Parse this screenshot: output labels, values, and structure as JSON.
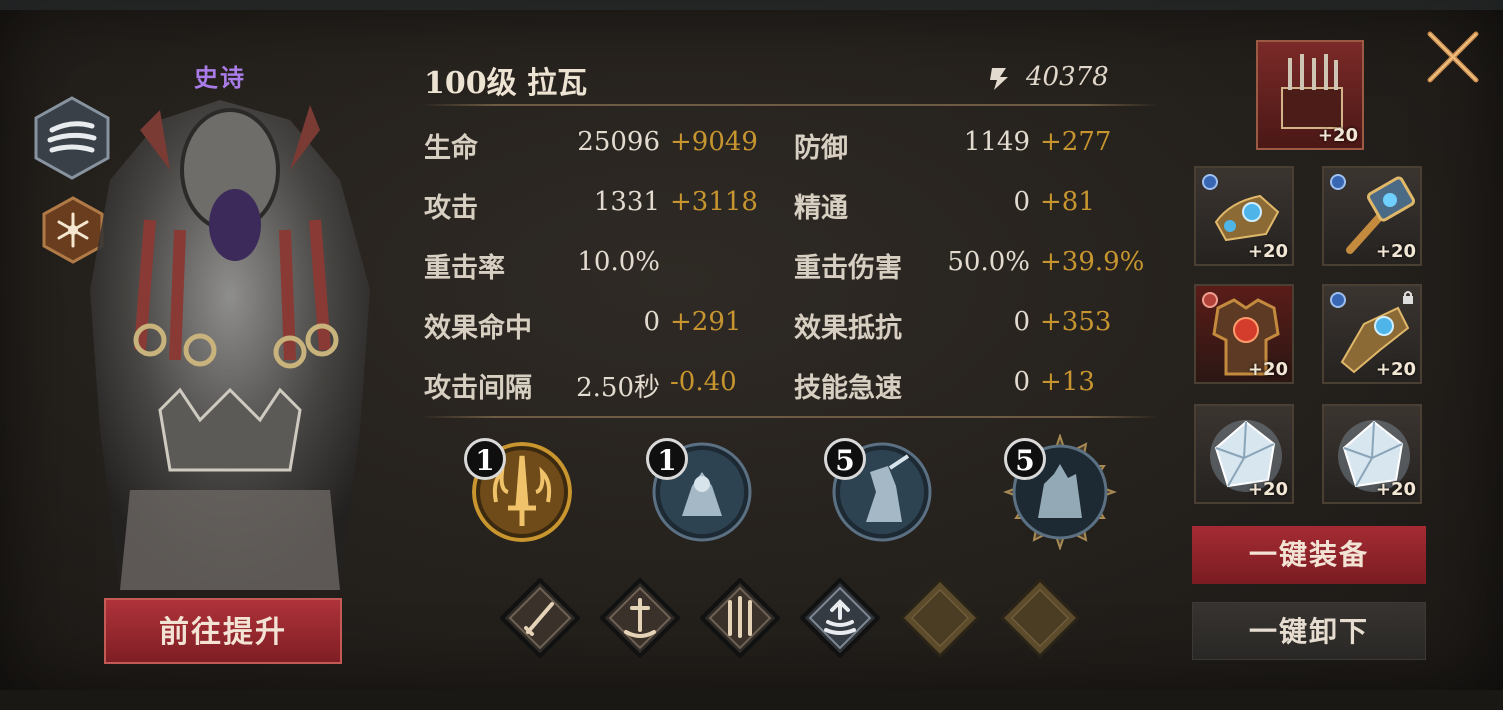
{
  "hero": {
    "rarity": "史诗",
    "title": "100级 拉瓦",
    "power": "40378",
    "upgrade_button": "前往提升",
    "class_icon": "wind-icon",
    "element_icon": "ice-star-icon"
  },
  "stats": [
    {
      "label": "生命",
      "base": "25096",
      "bonus": "+9049"
    },
    {
      "label": "防御",
      "base": "1149",
      "bonus": "+277"
    },
    {
      "label": "攻击",
      "base": "1331",
      "bonus": "+3118"
    },
    {
      "label": "精通",
      "base": "0",
      "bonus": "+81"
    },
    {
      "label": "重击率",
      "base": "10.0%",
      "bonus": ""
    },
    {
      "label": "重击伤害",
      "base": "50.0%",
      "bonus": "+39.9%"
    },
    {
      "label": "效果命中",
      "base": "0",
      "bonus": "+291"
    },
    {
      "label": "效果抵抗",
      "base": "0",
      "bonus": "+353"
    },
    {
      "label": "攻击间隔",
      "base": "2.50秒",
      "bonus": "-0.40"
    },
    {
      "label": "技能急速",
      "base": "0",
      "bonus": "+13"
    }
  ],
  "skills": [
    {
      "level": "1",
      "icon": "flaming-sword-skill-icon"
    },
    {
      "level": "1",
      "icon": "demon-skill-icon"
    },
    {
      "level": "5",
      "icon": "warrior-skill-icon"
    },
    {
      "level": "5",
      "icon": "crystal-skill-icon"
    }
  ],
  "talents": [
    "sword-icon",
    "sword-stand-icon",
    "tri-sword-icon",
    "upgrade-icon",
    "locked-slot-icon",
    "locked-slot-icon"
  ],
  "equipment": {
    "artifact": {
      "plus": "+20",
      "icon": "organ-artifact-icon"
    },
    "slots": [
      {
        "plus": "+20",
        "icon": "gauntlet-icon"
      },
      {
        "plus": "+20",
        "icon": "hammer-icon"
      },
      {
        "plus": "+20",
        "icon": "armor-icon"
      },
      {
        "plus": "+20",
        "icon": "bracer-icon"
      },
      {
        "plus": "+20",
        "icon": "ice-crystal-icon"
      },
      {
        "plus": "+20",
        "icon": "ice-crystal-icon"
      }
    ],
    "equip_all": "一键装备",
    "unequip_all": "一键卸下"
  },
  "colors": {
    "rarity": "#a97ce8",
    "bonus": "#c7952f",
    "primary_button": "#a52b33"
  }
}
